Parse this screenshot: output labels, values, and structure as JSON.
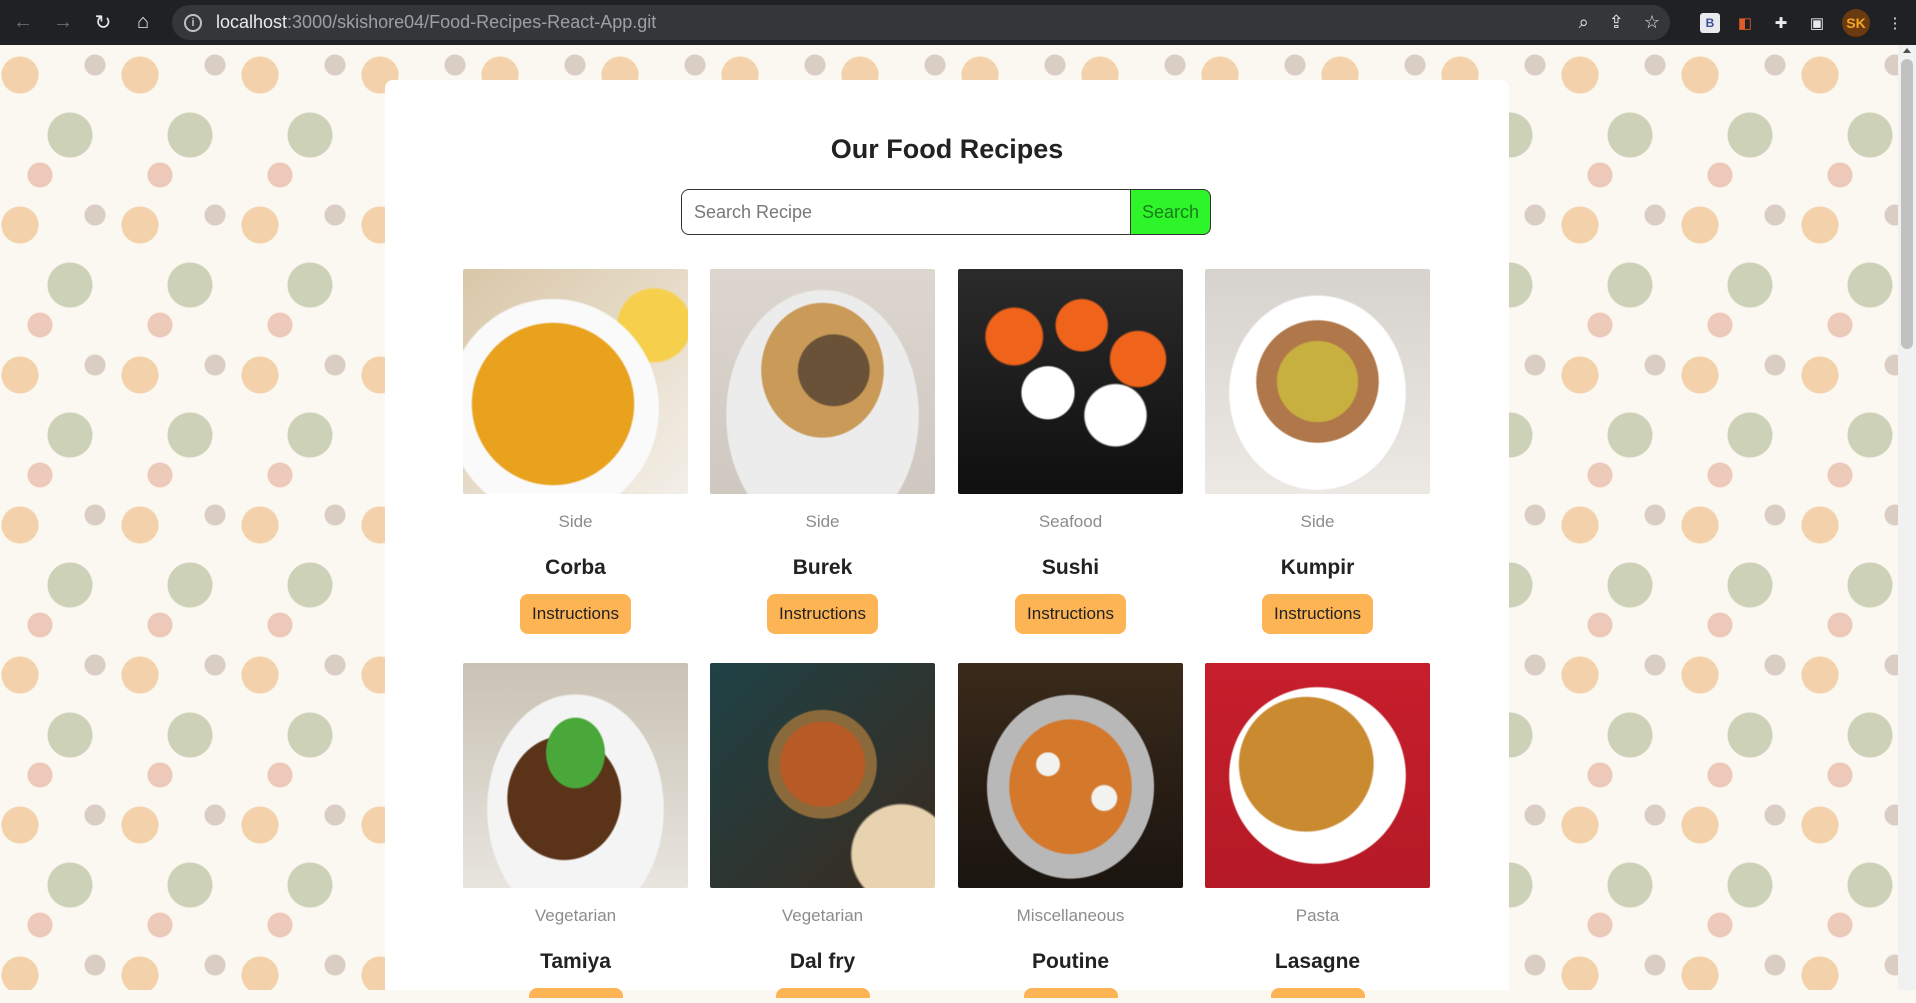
{
  "browser": {
    "url_host": "localhost",
    "url_path": ":3000/skishore04/Food-Recipes-React-App.git",
    "profile_initials": "SK",
    "ext_b_label": "B"
  },
  "app": {
    "title": "Our Food Recipes",
    "search": {
      "placeholder": "Search Recipe",
      "value": "",
      "button_label": "Search"
    },
    "instructions_label": "Instructions",
    "recipes": [
      {
        "category": "Side",
        "name": "Corba"
      },
      {
        "category": "Side",
        "name": "Burek"
      },
      {
        "category": "Seafood",
        "name": "Sushi"
      },
      {
        "category": "Side",
        "name": "Kumpir"
      },
      {
        "category": "Vegetarian",
        "name": "Tamiya"
      },
      {
        "category": "Vegetarian",
        "name": "Dal fry"
      },
      {
        "category": "Miscellaneous",
        "name": "Poutine"
      },
      {
        "category": "Pasta",
        "name": "Lasagne"
      }
    ]
  },
  "colors": {
    "search_button": "#2ef52a",
    "instructions_button": "#fdb455",
    "container": "#ffffff"
  }
}
